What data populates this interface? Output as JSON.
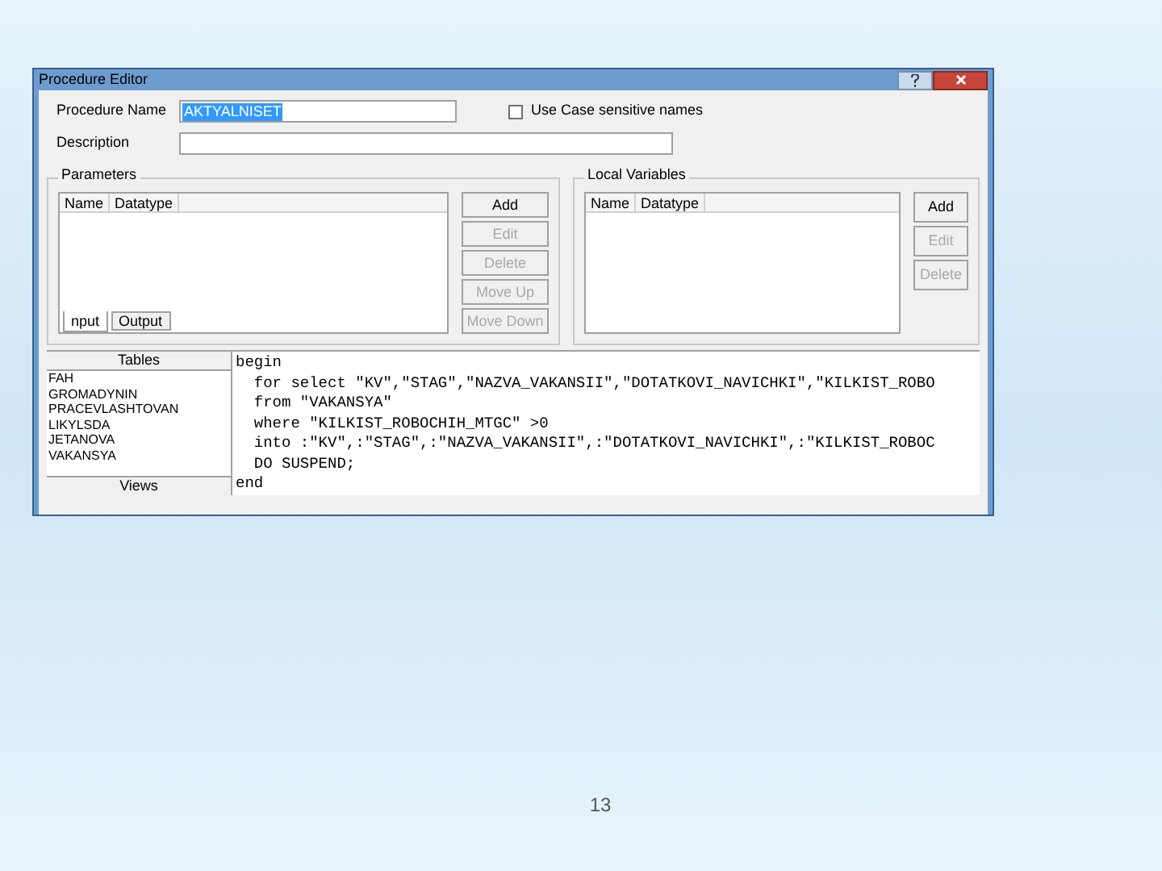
{
  "window": {
    "title": "Procedure Editor"
  },
  "procedure_name": {
    "label": "Procedure Name",
    "value": "AKTYALNISET"
  },
  "case_sensitive": {
    "label": "Use Case sensitive names",
    "checked": false
  },
  "description": {
    "label": "Description"
  },
  "parameters": {
    "title": "Parameters",
    "columns": [
      "Name",
      "Datatype"
    ],
    "buttons": [
      {
        "label": "Add",
        "disabled": false
      },
      {
        "label": "Edit",
        "disabled": true
      },
      {
        "label": "Delete",
        "disabled": true
      },
      {
        "label": "Move Up",
        "disabled": true
      },
      {
        "label": "Move Down",
        "disabled": true
      }
    ],
    "tabs": [
      {
        "label": "nput",
        "selected": true
      },
      {
        "label": "Output",
        "selected": false
      }
    ]
  },
  "local_variables": {
    "title": "Local Variables",
    "columns": [
      "Name",
      "Datatype"
    ],
    "buttons": [
      {
        "label": "Add",
        "disabled": false
      },
      {
        "label": "Edit",
        "disabled": true
      },
      {
        "label": "Delete",
        "disabled": true
      }
    ]
  },
  "tables": {
    "header": "Tables",
    "items": [
      "FAH",
      "GROMADYNIN",
      "PRACEVLASHTOVAN",
      "LIKYLSDA",
      "JETANOVA",
      "VAKANSYA"
    ],
    "footer": "Views"
  },
  "code": [
    "begin",
    "  for select \"KV\",\"STAG\",\"NAZVA_VAKANSII\",\"DOTATKOVI_NAVICHKI\",\"KILKIST_ROBO",
    "  from \"VAKANSYA\"",
    "  where \"KILKIST_ROBOCHIH_MTGC\" >0",
    "  into :\"KV\",:\"STAG\",:\"NAZVA_VAKANSII\",:\"DOTATKOVI_NAVICHKI\",:\"KILKIST_ROBOC",
    "  DO SUSPEND;",
    "end"
  ],
  "slide_number": "13"
}
